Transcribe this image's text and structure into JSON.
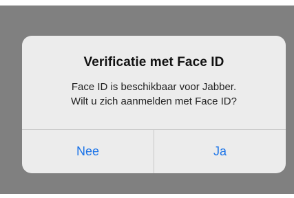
{
  "alert": {
    "title": "Verificatie met Face ID",
    "message_line1": "Face ID is beschikbaar voor Jabber.",
    "message_line2": "Wilt u zich aanmelden met Face ID?",
    "buttons": {
      "no": "Nee",
      "yes": "Ja"
    }
  },
  "colors": {
    "overlay": "#808080",
    "dialog": "#ececec",
    "action": "#1a73e8"
  }
}
